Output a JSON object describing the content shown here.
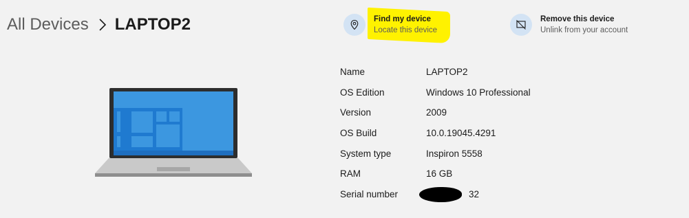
{
  "breadcrumb": {
    "root": "All Devices",
    "current": "LAPTOP2"
  },
  "actions": {
    "find": {
      "title": "Find my device",
      "subtitle": "Locate this device",
      "icon": "location-pin-icon"
    },
    "remove": {
      "title": "Remove this device",
      "subtitle": "Unlink from your account",
      "icon": "remove-device-icon"
    }
  },
  "specs": [
    {
      "label": "Name",
      "value": "LAPTOP2"
    },
    {
      "label": "OS Edition",
      "value": "Windows 10 Professional"
    },
    {
      "label": "Version",
      "value": "2009"
    },
    {
      "label": "OS Build",
      "value": "10.0.19045.4291"
    },
    {
      "label": "System type",
      "value": "Inspiron 5558"
    },
    {
      "label": "RAM",
      "value": "16 GB"
    },
    {
      "label": "Serial number",
      "value": "32"
    }
  ],
  "colors": {
    "background": "#f2f2f2",
    "icon_circle": "#d3e3f4",
    "accent": "#0f6cbd",
    "highlight": "#fff200",
    "screen_blue": "#3c97e0"
  }
}
